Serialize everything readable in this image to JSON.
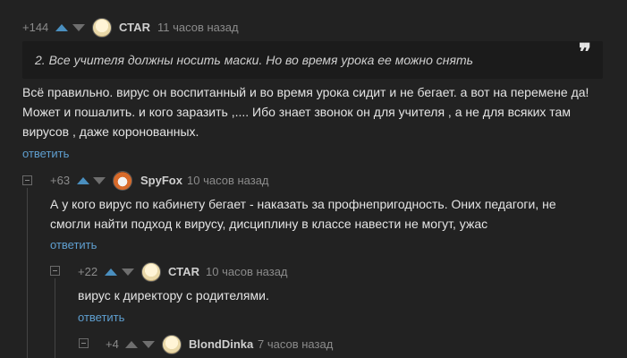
{
  "comments": [
    {
      "rating": "+144",
      "username": "СТАR",
      "time": "11 часов назад",
      "quote": "2. Все учителя должны носить маски. Но во время урока ее можно снять",
      "quote_mark": "❞",
      "lines": [
        "Всё правильно. вирус он воспитанный и во время урока сидит и не бегает. а вот на перемене да!",
        "Может и пошалить. и кого заразить ,.... Ибо знает звонок он для учителя , а не для всяких там",
        "вирусов , даже коронованных."
      ],
      "reply": "ответить"
    },
    {
      "rating": "+63",
      "username": "SpyFox",
      "time": "10 часов назад",
      "lines": [
        "А у кого вирус по кабинету бегает - наказать за профнепригодность. Оних педагоги, не",
        "смогли найти подход к вирусу, дисциплину в классе навести не могут, ужас"
      ],
      "reply": "ответить"
    },
    {
      "rating": "+22",
      "username": "СТАR",
      "time": "10 часов назад",
      "lines": [
        "вирус к директору с родителями."
      ],
      "reply": "ответить"
    },
    {
      "rating": "+4",
      "username": "BlondDinka",
      "time": "7 часов назад"
    }
  ],
  "colors": {
    "background": "#222222",
    "text": "#e4e4e4",
    "link": "#5f9fd0",
    "upvote_active": "#4a8fbf",
    "muted": "#8b8b8b"
  }
}
